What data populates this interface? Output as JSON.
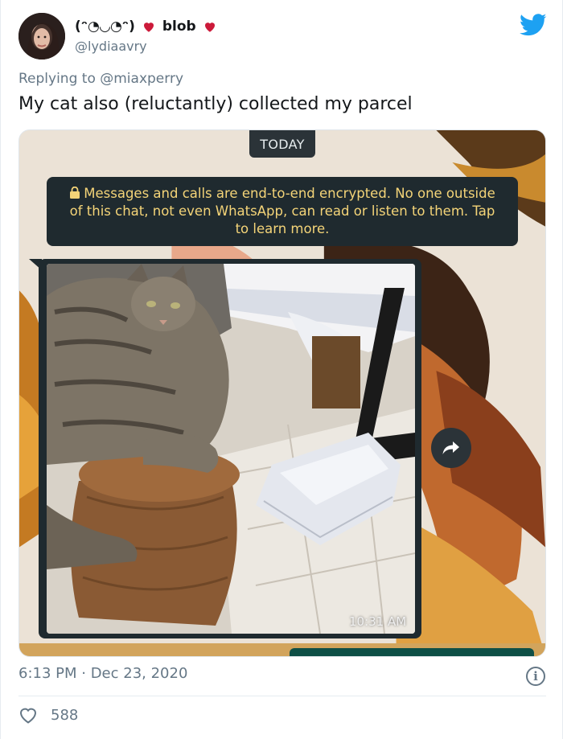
{
  "author": {
    "display_name": "(ᵔ◔◡◔ᵔ)",
    "display_suffix": "blob",
    "handle": "@lydiaavry"
  },
  "reply": {
    "prefix": "Replying to",
    "mention": "@miaxperry"
  },
  "tweet": {
    "text": "My cat also (reluctantly) collected my parcel"
  },
  "media": {
    "date_chip": "TODAY",
    "encryption_notice": "Messages and calls are end-to-end encrypted. No one outside of this chat, not even WhatsApp, can read or listen to them. Tap to learn more.",
    "message_time": "10:31 AM",
    "icons": [
      "lock-icon",
      "forward-icon"
    ]
  },
  "meta": {
    "timestamp": "6:13 PM · Dec 23, 2020"
  },
  "engagement": {
    "likes": "588"
  },
  "colors": {
    "twitter_blue": "#1da1f2",
    "heart_red": "#e0245e",
    "muted_text": "#657786",
    "whatsapp_notice_text": "#f4d478",
    "whatsapp_bubble": "#1f2a2f"
  }
}
